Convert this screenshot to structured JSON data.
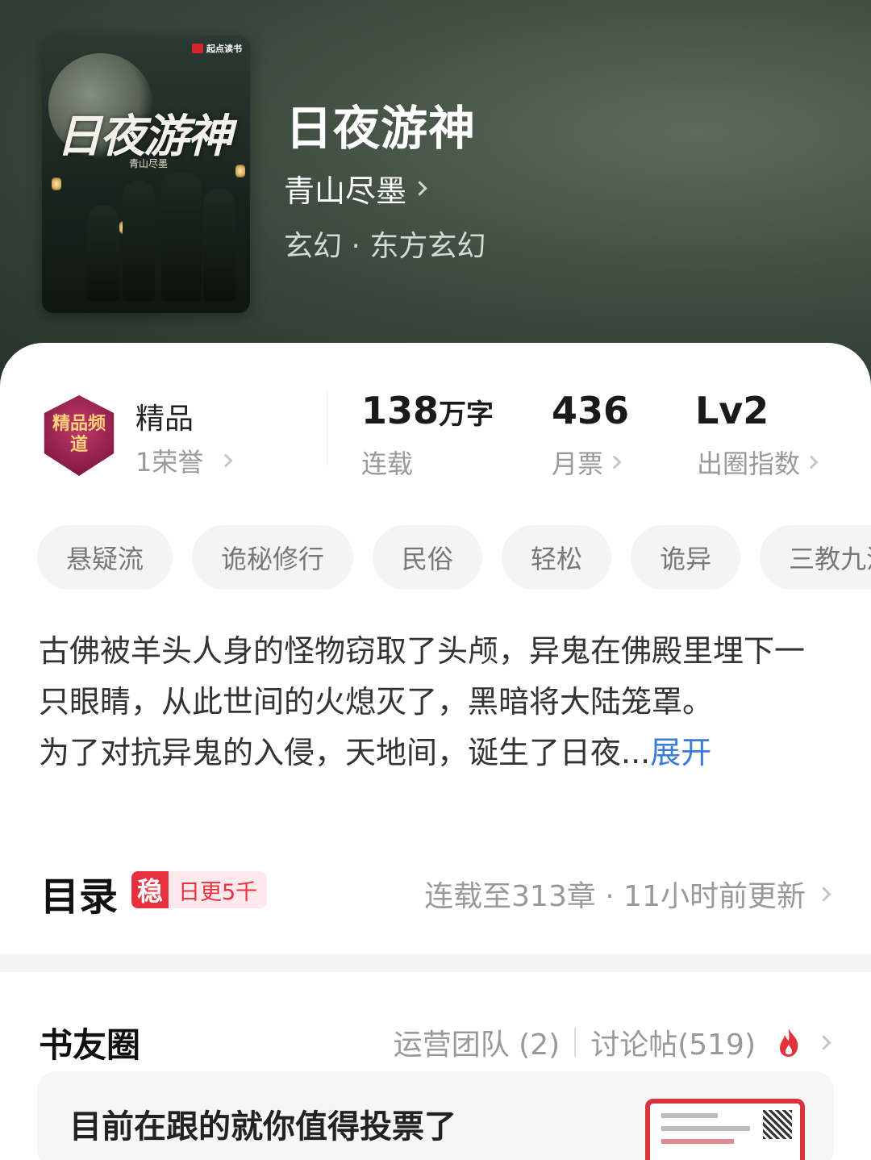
{
  "cover": {
    "badge": "起点读书",
    "title": "日夜游神",
    "author": "青山尽墨"
  },
  "book": {
    "title": "日夜游神",
    "author": "青山尽墨",
    "genre": "玄幻 · 东方玄幻"
  },
  "honor": {
    "badge_text": "精品频道",
    "name": "精品",
    "sub": "1荣誉"
  },
  "stats": [
    {
      "value": "138",
      "unit": "万字",
      "label": "连载"
    },
    {
      "value": "436",
      "unit": "",
      "label": "月票"
    },
    {
      "value": "Lv2",
      "unit": "",
      "label": "出圈指数"
    }
  ],
  "tags": [
    "悬疑流",
    "诡秘修行",
    "民俗",
    "轻松",
    "诡异",
    "三教九流"
  ],
  "description": {
    "text": "古佛被羊头人身的怪物窃取了头颅，异鬼在佛殿里埋下一只眼睛，从此世间的火熄灭了，黑暗将大陆笼罩。",
    "text2": "为了对抗异鬼的入侵，天地间，诞生了日夜...",
    "more": "展开"
  },
  "toc": {
    "title": "目录",
    "badge_icon": "稳",
    "badge_text": "日更5千",
    "info": "连载至313章 · 11小时前更新"
  },
  "circle": {
    "title": "书友圈",
    "team": "运营团队 (2)",
    "posts": "讨论帖(519)",
    "icon": "fire-icon",
    "post_title": "目前在跟的就你值得投票了"
  },
  "colors": {
    "accent_blue": "#3a7ad8",
    "badge_red": "#e8313f"
  }
}
